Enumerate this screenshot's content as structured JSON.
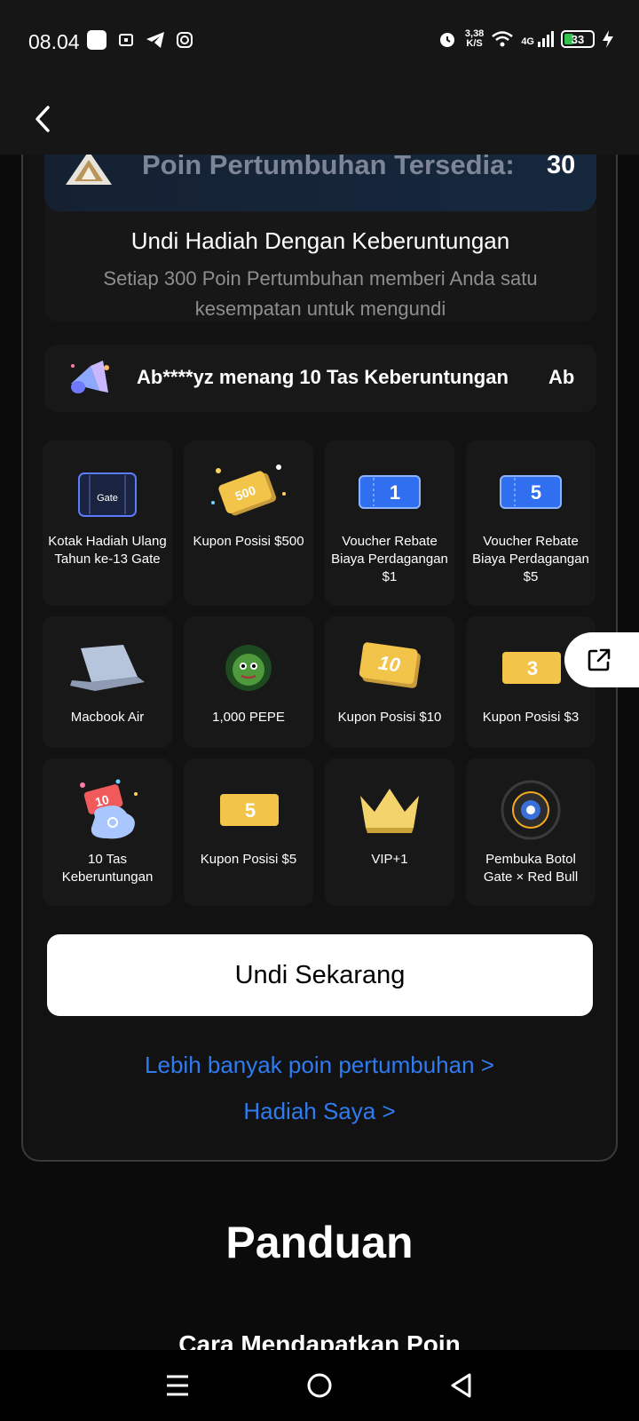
{
  "status_bar": {
    "time": "08.04",
    "net_speed_value": "3,38",
    "net_speed_unit": "K/S",
    "network": "4G",
    "battery": "33"
  },
  "points": {
    "label": "Poin Pertumbuhan Tersedia:",
    "value": "30"
  },
  "draw": {
    "title": "Undi Hadiah Dengan Keberuntungan",
    "description": "Setiap 300 Poin Pertumbuhan memberi Anda satu kesempatan untuk mengundi"
  },
  "ticker": {
    "text": "Ab****yz menang 10 Tas Keberuntungan",
    "text_next": "Ab"
  },
  "prizes": [
    {
      "label": "Kotak Hadiah Ulang Tahun ke-13 Gate",
      "icon": "gift-box-icon",
      "box_text": "Gate"
    },
    {
      "label": "Kupon Posisi $500",
      "icon": "coupon-icon",
      "badge": "500"
    },
    {
      "label": "Voucher Rebate Biaya Perdagangan $1",
      "icon": "voucher-icon",
      "badge": "1"
    },
    {
      "label": "Voucher Rebate Biaya Perdagangan $5",
      "icon": "voucher-icon",
      "badge": "5"
    },
    {
      "label": "Macbook Air",
      "icon": "laptop-icon"
    },
    {
      "label": "1,000 PEPE",
      "icon": "pepe-coin-icon"
    },
    {
      "label": "Kupon Posisi $10",
      "icon": "coupon-icon",
      "badge": "10"
    },
    {
      "label": "Kupon Posisi $3",
      "icon": "coupon-icon",
      "badge": "3"
    },
    {
      "label": "10 Tas Keberuntungan",
      "icon": "lucky-bag-icon",
      "badge": "10"
    },
    {
      "label": "Kupon Posisi $5",
      "icon": "coupon-icon",
      "badge": "5"
    },
    {
      "label": "VIP+1",
      "icon": "crown-icon"
    },
    {
      "label": "Pembuka Botol Gate × Red Bull",
      "icon": "tire-icon"
    }
  ],
  "actions": {
    "draw_now": "Undi Sekarang",
    "more_points": "Lebih banyak poin pertumbuhan  >",
    "my_prizes": "Hadiah Saya  >"
  },
  "guide": {
    "title": "Panduan",
    "subtitle": "Cara Mendapatkan Poin"
  },
  "colors": {
    "accent_link": "#2f7bf0",
    "background": "#0b0b0b",
    "voucher_blue": "#2f6ff0",
    "coupon_gold": "#f3c44a"
  }
}
